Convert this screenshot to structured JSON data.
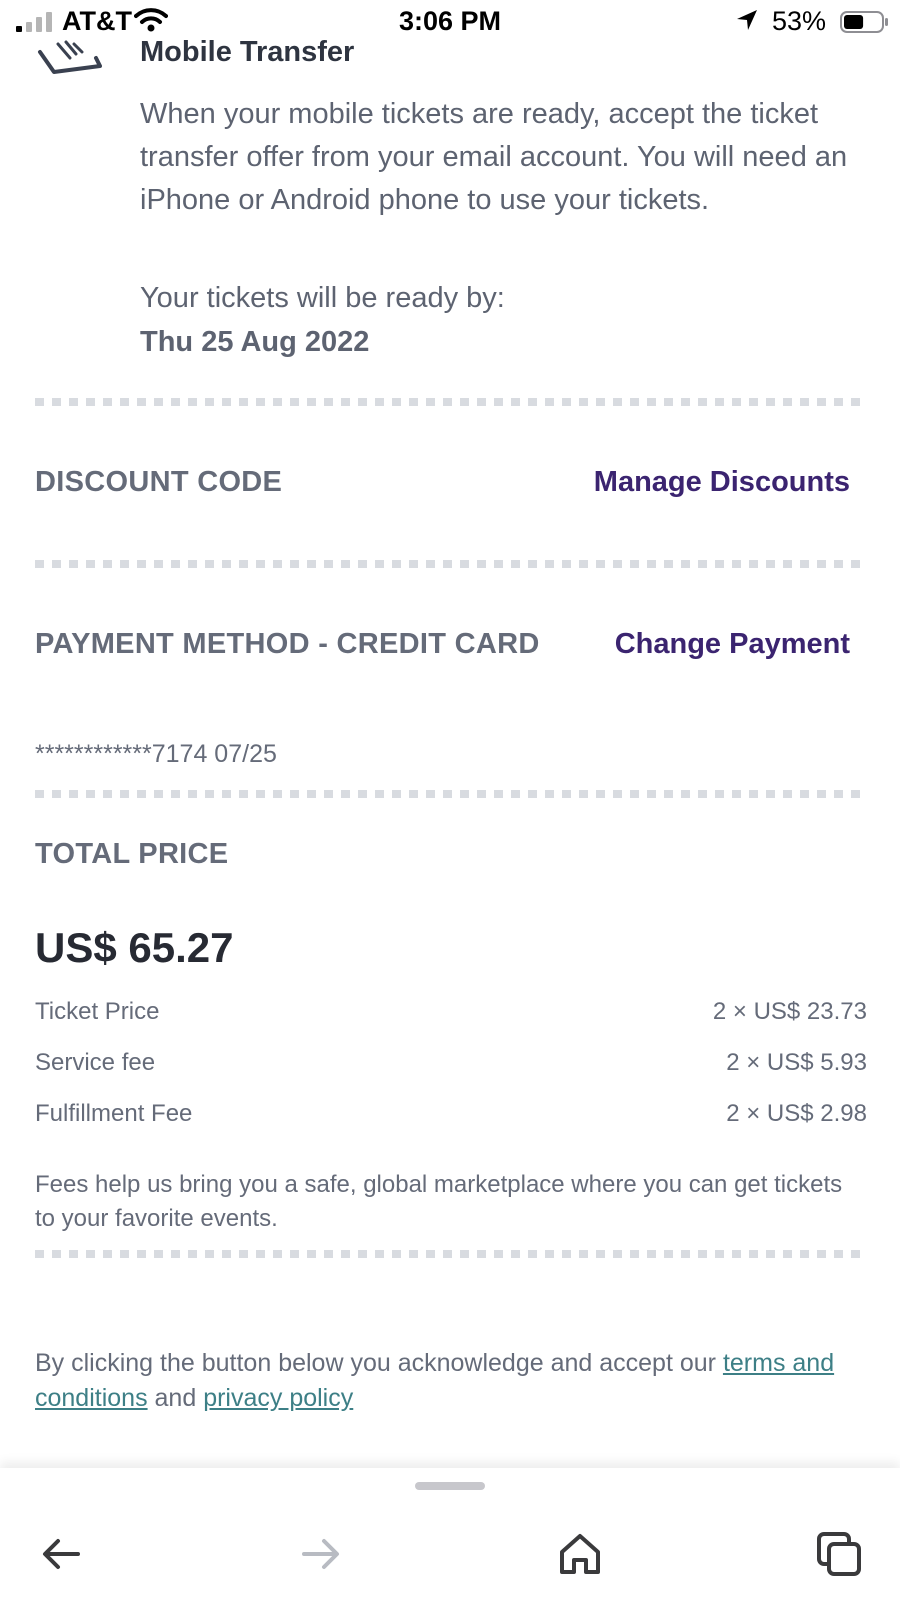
{
  "status_bar": {
    "carrier": "AT&T",
    "time": "3:06 PM",
    "battery_percent": "53%",
    "battery_level": 0.53
  },
  "transfer": {
    "title": "Mobile Transfer",
    "body": "When your mobile tickets are ready, accept the ticket transfer offer from your email account. You will need an iPhone or Android phone to use your tickets.",
    "ready_label": "Your tickets will be ready by:",
    "ready_date": "Thu 25 Aug 2022"
  },
  "discount": {
    "heading": "DISCOUNT CODE",
    "action": "Manage Discounts"
  },
  "payment": {
    "heading": "PAYMENT METHOD - CREDIT CARD",
    "action": "Change Payment",
    "card": "************7174 07/25"
  },
  "total": {
    "heading": "TOTAL PRICE",
    "amount": "US$ 65.27",
    "rows": [
      {
        "label": "Ticket Price",
        "value": "2 × US$ 23.73"
      },
      {
        "label": "Service fee",
        "value": "2 × US$ 5.93"
      },
      {
        "label": "Fulfillment Fee",
        "value": "2 × US$ 2.98"
      }
    ],
    "note": "Fees help us bring you a safe, global marketplace where you can get tickets to your favorite events."
  },
  "legal": {
    "prefix": "By clicking the button below you acknowledge and accept our ",
    "terms_link": "terms and conditions",
    "middle": " and ",
    "privacy_link": "privacy policy"
  },
  "colors": {
    "link_purple": "#3b2470",
    "link_teal": "#3d7f86",
    "heading_gray": "#656b79"
  },
  "icons": {
    "back": "arrow-left-icon",
    "forward": "arrow-right-icon",
    "home": "home-icon",
    "tabs": "tabs-icon"
  }
}
